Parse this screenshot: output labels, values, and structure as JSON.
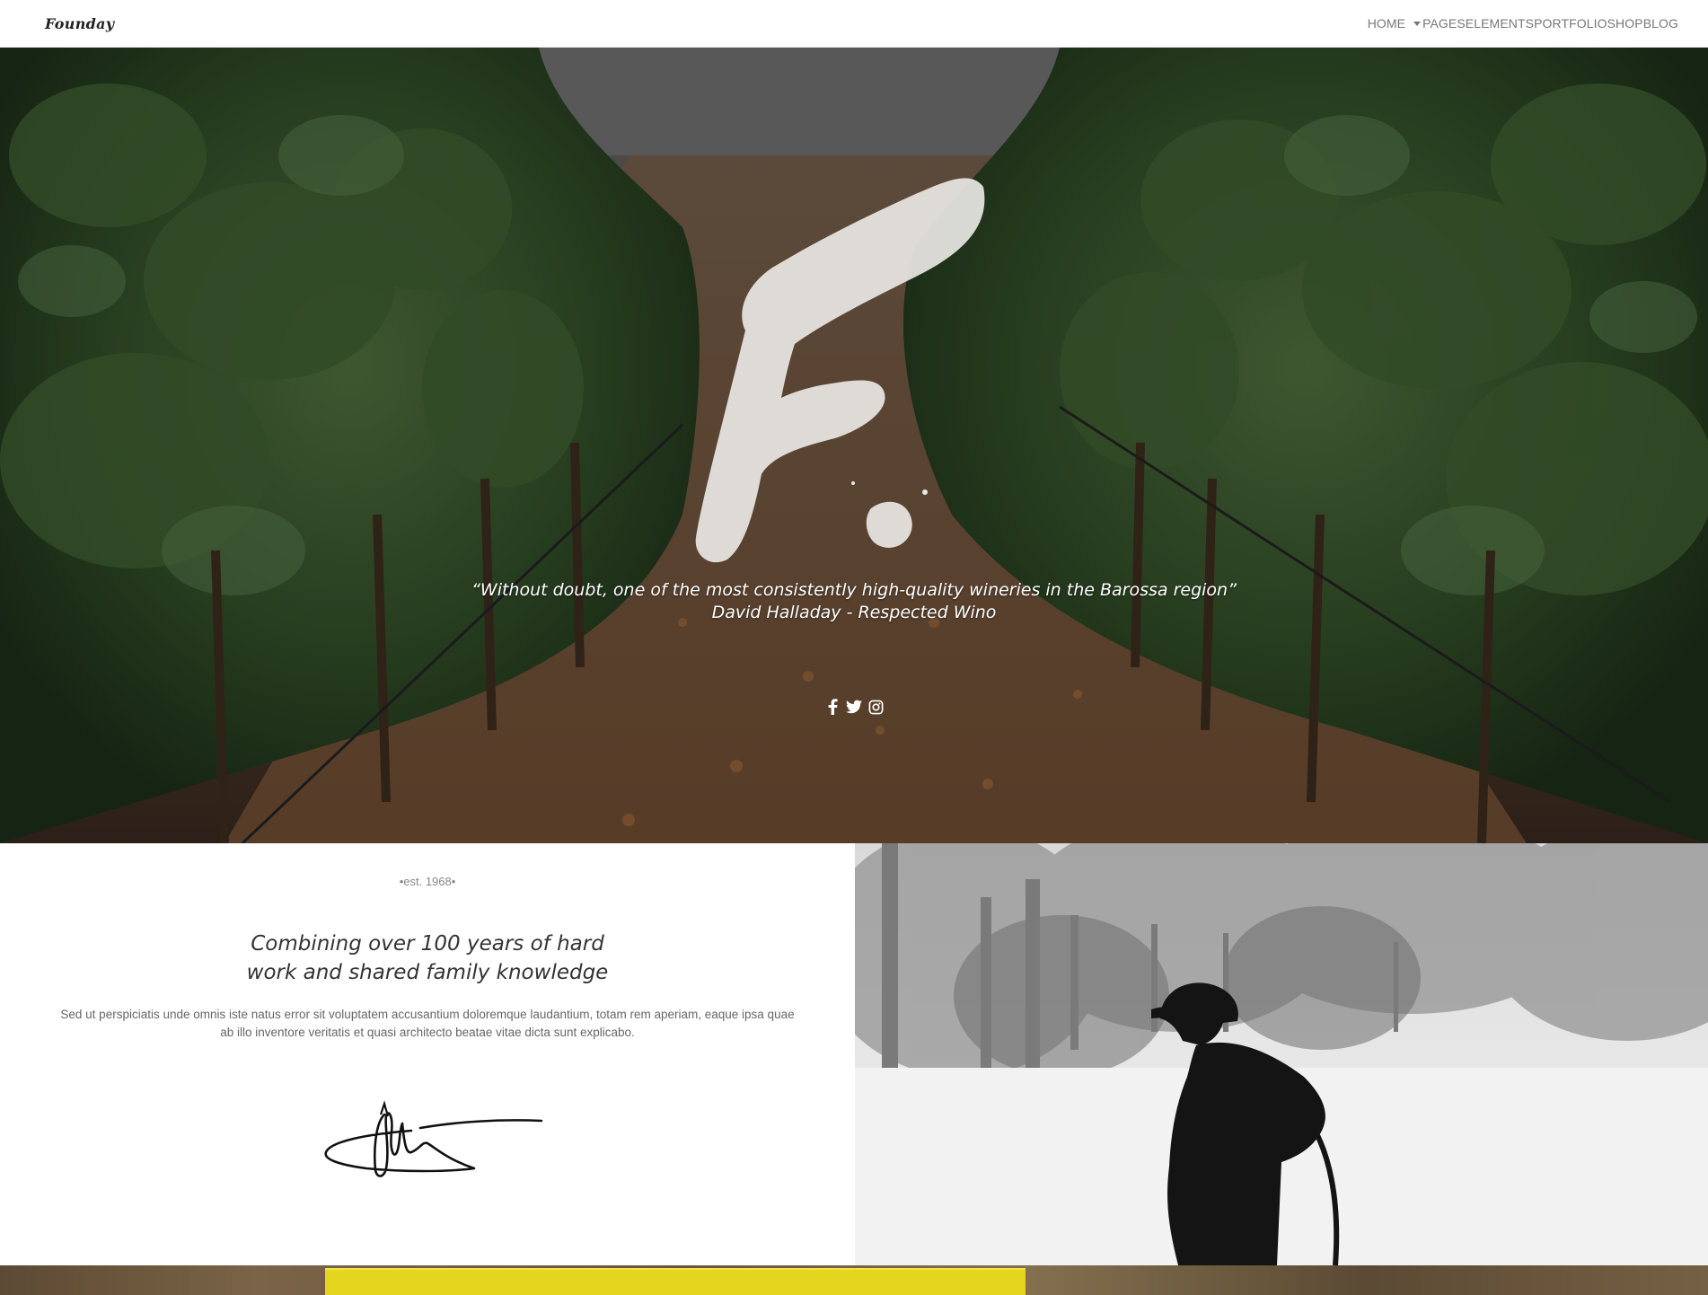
{
  "brand": {
    "logo_text": "Founday"
  },
  "nav": {
    "items": [
      {
        "label": "HOME",
        "has_dropdown": false
      },
      {
        "label": "PAGES",
        "has_dropdown": true
      },
      {
        "label": "ELEMENTS",
        "has_dropdown": false
      },
      {
        "label": "PORTFOLIO",
        "has_dropdown": false
      },
      {
        "label": "SHOP",
        "has_dropdown": false
      },
      {
        "label": "BLOG",
        "has_dropdown": false
      }
    ]
  },
  "hero": {
    "quote": "“Without doubt, one of the most consistently high-quality wineries in the Barossa region”",
    "author": "David Halladay - Respected Wino",
    "social_icons": [
      "facebook-icon",
      "twitter-icon",
      "instagram-icon"
    ]
  },
  "about": {
    "est": "•est. 1968•",
    "headline_line1": "Combining over 100 years of hard",
    "headline_line2": "work and shared family knowledge",
    "body": "Sed ut perspiciatis unde omnis iste natus error sit voluptatem accusantium doloremque laudantium, totam rem aperiam, eaque ipsa quae ab illo inventore veritatis et quasi architecto beatae vitae dicta sunt explicabo."
  },
  "colors": {
    "nav_text": "#777777",
    "logo": "#222222",
    "hero_text": "#ffffff",
    "headline": "#333333",
    "body_text": "#666666",
    "crate_yellow": "#e4d51f"
  }
}
